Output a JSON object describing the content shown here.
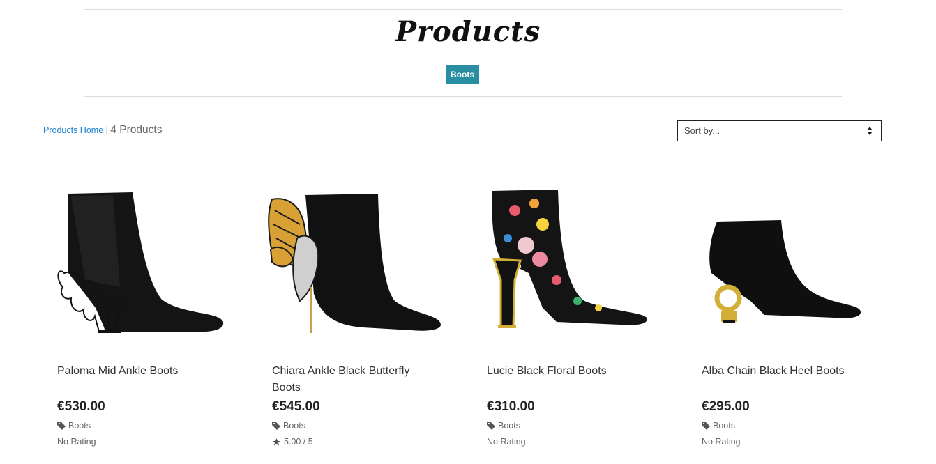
{
  "header": {
    "title": "Products",
    "category_badge": "Boots"
  },
  "breadcrumb": {
    "home_link": "Products Home",
    "separator": "|",
    "count": "4 Products"
  },
  "sort": {
    "label": "Sort by..."
  },
  "colors": {
    "accent": "#2a8ea3",
    "link": "#1a7fd1"
  },
  "products": [
    {
      "name": "Paloma Mid Ankle Boots",
      "price": "€530.00",
      "category": "Boots",
      "rating": "No Rating"
    },
    {
      "name": "Chiara Ankle Black Butterfly Boots",
      "price": "€545.00",
      "category": "Boots",
      "rating": "5.00 / 5"
    },
    {
      "name": "Lucie Black Floral Boots",
      "price": "€310.00",
      "category": "Boots",
      "rating": "No Rating"
    },
    {
      "name": "Alba Chain Black Heel Boots",
      "price": "€295.00",
      "category": "Boots",
      "rating": "No Rating"
    }
  ]
}
